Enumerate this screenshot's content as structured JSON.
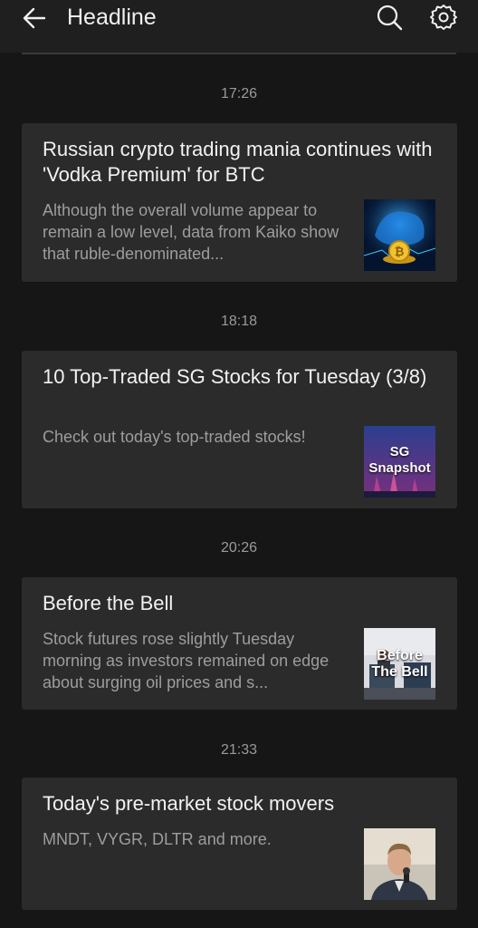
{
  "header": {
    "title": "Headline"
  },
  "articles": [
    {
      "time": "17:26",
      "headline": "Russian crypto trading mania continues with 'Vodka Premium' for BTC",
      "summary": "Although the overall volume appear to remain a low level, data from Kaiko show that ruble-denominated...",
      "thumb_label": ""
    },
    {
      "time": "18:18",
      "headline": "10 Top-Traded SG Stocks for Tuesday (3/8)",
      "summary": "Check out today's top-traded stocks!",
      "thumb_label": "SG Snapshot"
    },
    {
      "time": "20:26",
      "headline": "Before the Bell",
      "summary": "Stock futures rose slightly Tuesday morning as investors remained on edge about surging oil prices and s...",
      "thumb_label": "Before The Bell"
    },
    {
      "time": "21:33",
      "headline": "Today's pre-market stock movers",
      "summary": "MNDT, VYGR, DLTR and more.",
      "thumb_label": ""
    }
  ]
}
